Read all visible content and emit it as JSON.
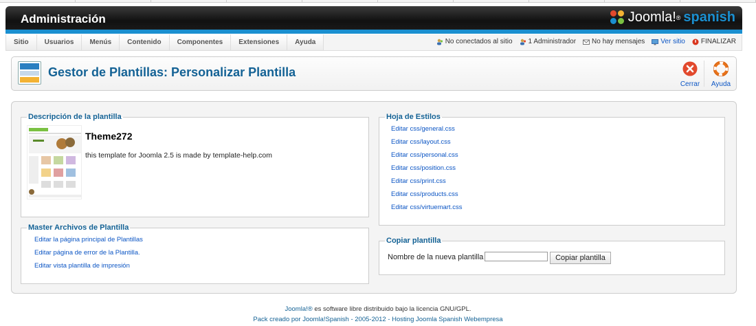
{
  "header": {
    "title": "Administración",
    "brand": "Joomla!",
    "brand_sup": "®",
    "brand_suffix": "spanish"
  },
  "menu": [
    "Sitio",
    "Usuarios",
    "Menús",
    "Contenido",
    "Componentes",
    "Extensiones",
    "Ayuda"
  ],
  "status": {
    "visitors": "No conectados al sitio",
    "admins": "1 Administrador",
    "messages": "No hay mensajes",
    "view_site": "Ver sitio",
    "logout": "FINALIZAR"
  },
  "toolbar": {
    "title": "Gestor de Plantillas: Personalizar Plantilla",
    "close_label": "Cerrar",
    "help_label": "Ayuda"
  },
  "description": {
    "legend": "Descripción de la plantilla",
    "name": "Theme272",
    "text": "this template for Joomla 2.5 is made by template-help.com"
  },
  "master_files": {
    "legend": "Master Archivos de Plantilla",
    "items": [
      "Editar la página principal de Plantillas",
      "Editar página de error de la Plantilla.",
      "Editar vista plantilla de impresión"
    ]
  },
  "stylesheets": {
    "legend": "Hoja de Estilos",
    "items": [
      "Editar css/general.css",
      "Editar css/layout.css",
      "Editar css/personal.css",
      "Editar css/position.css",
      "Editar css/print.css",
      "Editar css/products.css",
      "Editar css/virtuemart.css"
    ]
  },
  "copy": {
    "legend": "Copiar plantilla",
    "label": "Nombre de la nueva plantilla",
    "value": "",
    "button": "Copiar plantilla"
  },
  "footer": {
    "line1_link": "Joomla!®",
    "line1_text": " es software libre distribuido bajo la licencia GNU/GPL.",
    "line2": "Pack creado por Joomla!Spanish - 2005-2012 - Hosting Joomla Spanish Webempresa"
  },
  "colors": {
    "accent": "#1a8fd0",
    "title_blue": "#146295",
    "link_blue": "#0b55c4",
    "close_red": "#e2492d",
    "help_orange": "#e8731b"
  }
}
